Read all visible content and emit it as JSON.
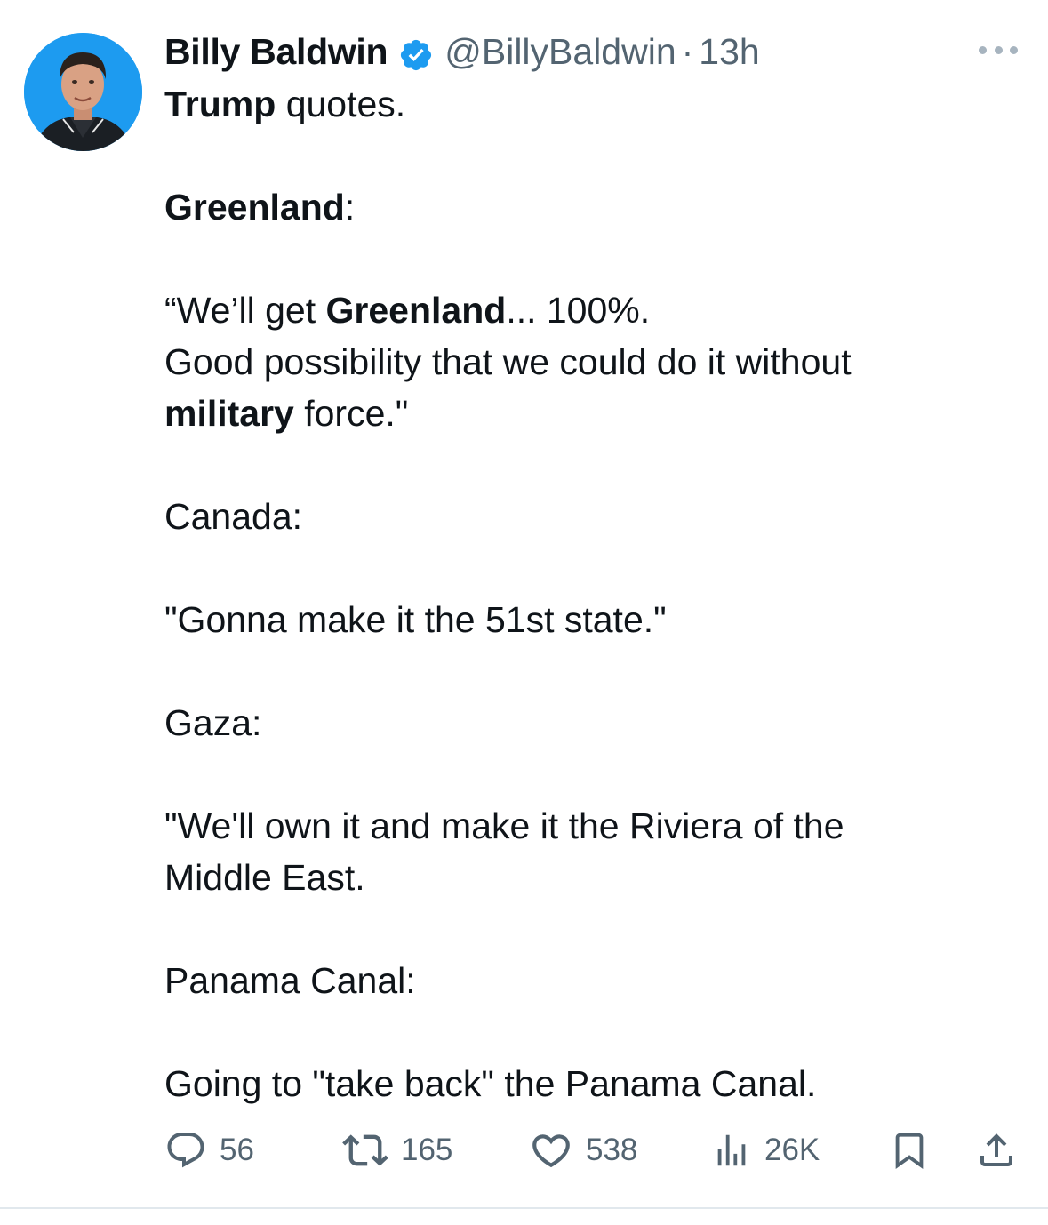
{
  "author": {
    "display_name": "Billy Baldwin",
    "handle": "@BillyBaldwin",
    "separator": "·",
    "time": "13h",
    "verified_icon": "verified-badge-icon",
    "verified_color": "#1d9bf0"
  },
  "tweet": {
    "line1_bold": "Trump",
    "line1_rest": " quotes.",
    "section1_heading_bold": "Greenland",
    "section1_heading_rest": ":",
    "quote1_open": "“We’ll get ",
    "quote1_bold": "Greenland",
    "quote1_rest": "... 100%.",
    "quote1_line2": "Good possibility that we could do it without",
    "quote1_line3_bold": "military",
    "quote1_line3_rest": " force.\"",
    "section2_heading": "Canada:",
    "quote2": "\"Gonna make it the 51st state.\"",
    "section3_heading": "Gaza:",
    "quote3_line1": "\"We'll own it and make it the Riviera of the",
    "quote3_line2": "Middle East.",
    "section4_heading": "Panama Canal:",
    "quote4": "Going to \"take back\" the Panama Canal."
  },
  "actions": {
    "replies": "56",
    "reposts": "165",
    "likes": "538",
    "views": "26K",
    "icons": [
      "reply-icon",
      "repost-icon",
      "like-icon",
      "views-icon",
      "bookmark-icon",
      "share-icon"
    ],
    "icon_color": "#536471"
  },
  "more_icon": "more-options-icon"
}
